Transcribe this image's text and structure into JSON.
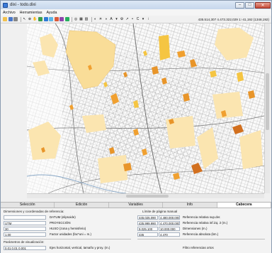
{
  "window": {
    "title": "dixi - todo.dixi"
  },
  "menu": [
    "Archivo",
    "Herramientas",
    "Ayuda"
  ],
  "toolbar": {
    "icons": [
      "open-icon",
      "save-icon",
      "print-icon",
      "pointer-icon",
      "zoom-icon",
      "hand-icon",
      "select-icon",
      "layers-icon",
      "table-icon",
      "edit-icon",
      "node-icon",
      "info-icon",
      "globe-icon",
      "map-icon",
      "grid-icon",
      "color-icon",
      "sun-icon",
      "contrast-icon",
      "text-icon",
      "measure-icon",
      "settings-icon",
      "arrow-icon",
      "circle-icon",
      "line-icon",
      "point-icon",
      "extra-icon"
    ],
    "coords": "435.514,307   4.473.322,029   1:-41,192 (1348,192)"
  },
  "tabs": [
    {
      "label": "Selección",
      "active": false
    },
    {
      "label": "Edición",
      "active": false
    },
    {
      "label": "Variables",
      "active": false
    },
    {
      "label": "Info",
      "active": false
    },
    {
      "label": "Cabecera",
      "active": true
    }
  ],
  "panel": {
    "section_ref": "Dimensiones y coordenadas de referencia:",
    "datum_value": "",
    "datum_label": "DATUM (elipsoide)",
    "proj_value": "UTM",
    "proj_label": "PROYECCIÓN",
    "huso_value": "30",
    "huso_label": "HUSO (zona y hemisferio)",
    "factor_value": "1,00",
    "factor_label": "Factor unidades (fac*uni = m.)",
    "section_limits": "Límite de página manual",
    "lim1_a": "445.025.090",
    "lim1_b": "4.480.000.000",
    "lim1_label": "Referencia relativa sup.der.",
    "lim2_a": "435.999.990",
    "lim2_b": "4.470.000.000",
    "lim2_label": "Referencia relativa inf.izq. 2 (m.)",
    "lim3_a": "9.025.100",
    "lim3_b": "10.000.000",
    "lim3_label": "Dimensiones (m.)",
    "lim4_a": "435",
    "lim4_b": "4.470",
    "lim4_label": "Referencia absoluta (km.)",
    "section_vis": "Parámetros de visualización:",
    "vis_values": "0,01  0,01  0,001",
    "vis_label": "Ejes horizontal, vertical, tamaño y proy. (m.)",
    "filter_label": "Filtro referencias ortos"
  }
}
